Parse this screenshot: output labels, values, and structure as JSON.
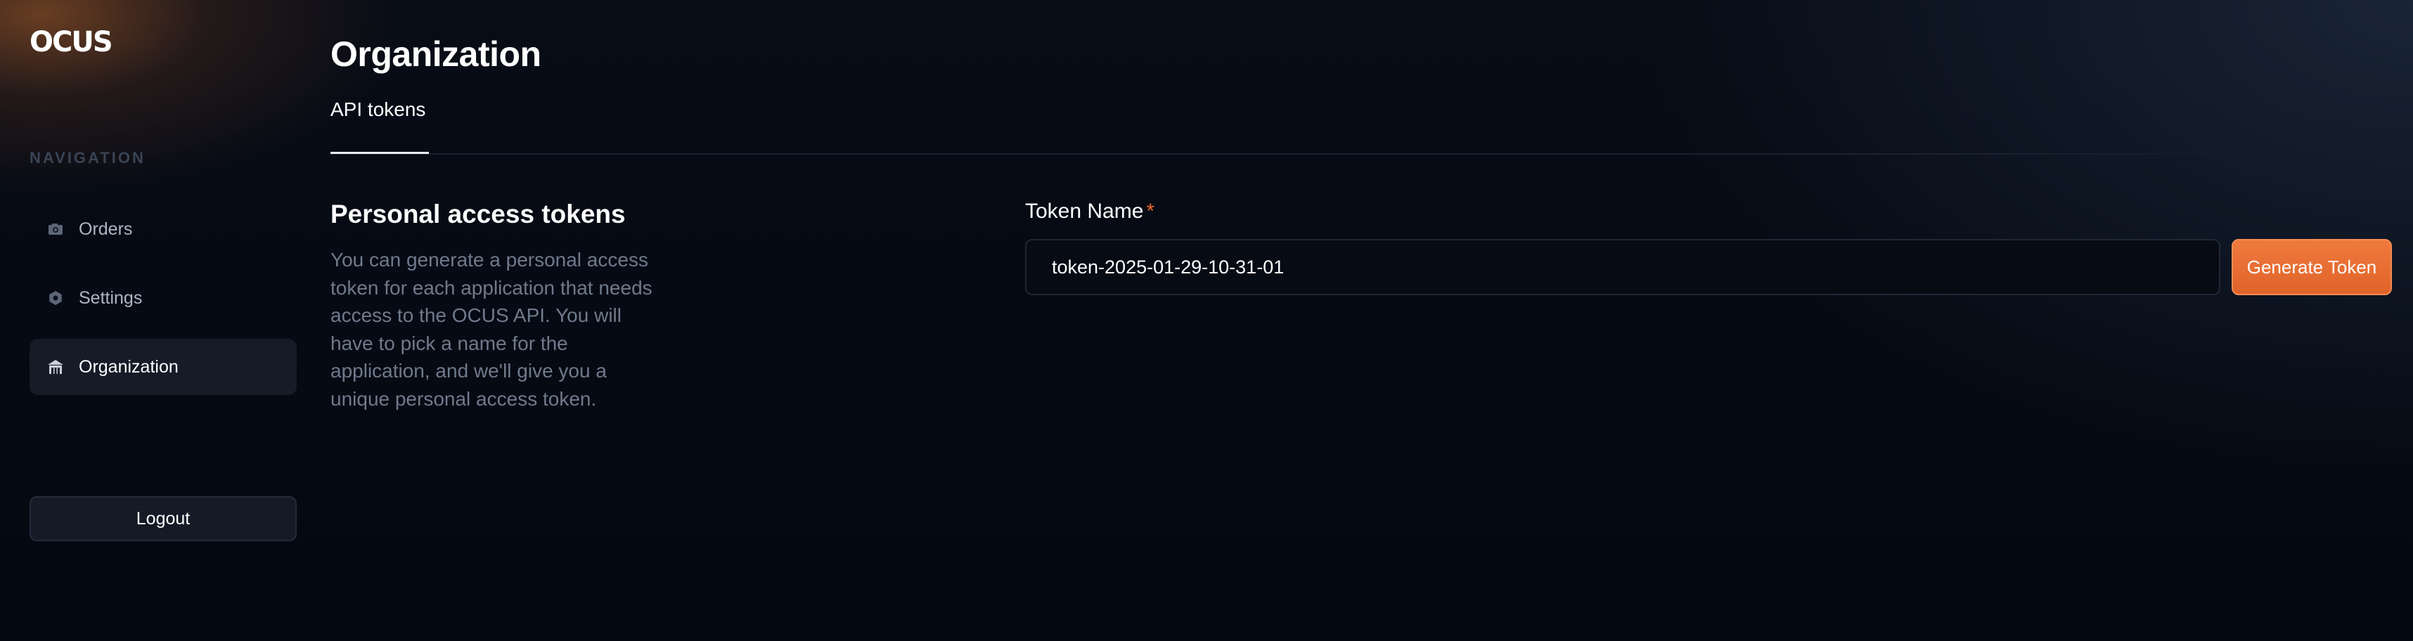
{
  "brand": {
    "logo_text": "OCUS"
  },
  "sidebar": {
    "heading": "NAVIGATION",
    "items": [
      {
        "label": "Orders",
        "icon": "camera-icon"
      },
      {
        "label": "Settings",
        "icon": "gear-icon"
      },
      {
        "label": "Organization",
        "icon": "building-icon",
        "active": true
      }
    ],
    "logout_label": "Logout"
  },
  "main": {
    "title": "Organization",
    "tabs": [
      {
        "label": "API tokens",
        "active": true
      }
    ],
    "section": {
      "title": "Personal access tokens",
      "description": "You can generate a personal access token for each application that needs access to the OCUS API. You will have to pick a name for the application, and we'll give you a unique personal access token."
    },
    "form": {
      "label": "Token Name",
      "required_mark": "*",
      "value": "token-2025-01-29-10-31-01",
      "submit_label": "Generate Token"
    }
  },
  "colors": {
    "accent": "#e7652a",
    "background": "#060b14",
    "active_nav": "#151b27",
    "muted_text": "#6f7a8c"
  }
}
